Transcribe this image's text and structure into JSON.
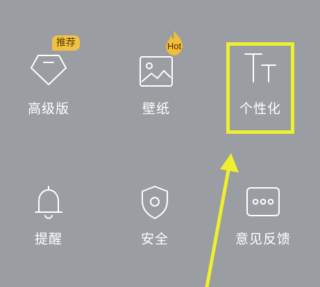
{
  "menu": {
    "items": [
      {
        "label": "高级版",
        "icon": "diamond-icon",
        "badge": "推荐"
      },
      {
        "label": "壁纸",
        "icon": "image-icon",
        "badge": "Hot"
      },
      {
        "label": "个性化",
        "icon": "font-size-icon"
      },
      {
        "label": "提醒",
        "icon": "bell-icon"
      },
      {
        "label": "安全",
        "icon": "shield-icon"
      },
      {
        "label": "意见反馈",
        "icon": "feedback-icon"
      }
    ]
  },
  "colors": {
    "background": "#9a9da1",
    "highlight": "#eef02d",
    "badge": "#f1c242",
    "text": "#ffffff"
  }
}
